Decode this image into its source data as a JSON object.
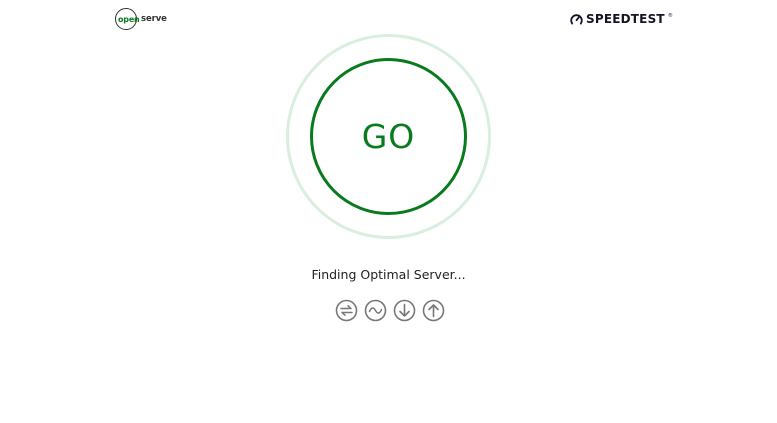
{
  "header": {
    "openserve_logo": {
      "open": "open",
      "serve": "serve"
    },
    "speedtest_logo": {
      "text": "SPEEDTEST",
      "tm": "®"
    }
  },
  "main": {
    "go_label": "GO",
    "status": "Finding Optimal Server..."
  },
  "icons": [
    {
      "name": "ping-icon"
    },
    {
      "name": "jitter-icon"
    },
    {
      "name": "download-icon"
    },
    {
      "name": "upload-icon"
    }
  ],
  "colors": {
    "accent": "#0a7a1e",
    "ring_light": "#d9efde",
    "icon_gray": "#777777",
    "text": "#222222"
  }
}
